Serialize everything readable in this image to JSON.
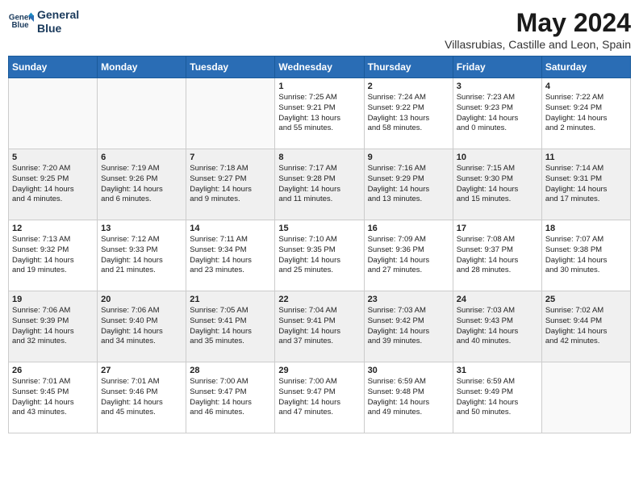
{
  "header": {
    "logo_line1": "General",
    "logo_line2": "Blue",
    "title": "May 2024",
    "location": "Villasrubias, Castille and Leon, Spain"
  },
  "days_of_week": [
    "Sunday",
    "Monday",
    "Tuesday",
    "Wednesday",
    "Thursday",
    "Friday",
    "Saturday"
  ],
  "weeks": [
    [
      {
        "day": "",
        "empty": true
      },
      {
        "day": "",
        "empty": true
      },
      {
        "day": "",
        "empty": true
      },
      {
        "day": "1",
        "lines": [
          "Sunrise: 7:25 AM",
          "Sunset: 9:21 PM",
          "Daylight: 13 hours",
          "and 55 minutes."
        ]
      },
      {
        "day": "2",
        "lines": [
          "Sunrise: 7:24 AM",
          "Sunset: 9:22 PM",
          "Daylight: 13 hours",
          "and 58 minutes."
        ]
      },
      {
        "day": "3",
        "lines": [
          "Sunrise: 7:23 AM",
          "Sunset: 9:23 PM",
          "Daylight: 14 hours",
          "and 0 minutes."
        ]
      },
      {
        "day": "4",
        "lines": [
          "Sunrise: 7:22 AM",
          "Sunset: 9:24 PM",
          "Daylight: 14 hours",
          "and 2 minutes."
        ]
      }
    ],
    [
      {
        "day": "5",
        "lines": [
          "Sunrise: 7:20 AM",
          "Sunset: 9:25 PM",
          "Daylight: 14 hours",
          "and 4 minutes."
        ],
        "shaded": true
      },
      {
        "day": "6",
        "lines": [
          "Sunrise: 7:19 AM",
          "Sunset: 9:26 PM",
          "Daylight: 14 hours",
          "and 6 minutes."
        ],
        "shaded": true
      },
      {
        "day": "7",
        "lines": [
          "Sunrise: 7:18 AM",
          "Sunset: 9:27 PM",
          "Daylight: 14 hours",
          "and 9 minutes."
        ],
        "shaded": true
      },
      {
        "day": "8",
        "lines": [
          "Sunrise: 7:17 AM",
          "Sunset: 9:28 PM",
          "Daylight: 14 hours",
          "and 11 minutes."
        ],
        "shaded": true
      },
      {
        "day": "9",
        "lines": [
          "Sunrise: 7:16 AM",
          "Sunset: 9:29 PM",
          "Daylight: 14 hours",
          "and 13 minutes."
        ],
        "shaded": true
      },
      {
        "day": "10",
        "lines": [
          "Sunrise: 7:15 AM",
          "Sunset: 9:30 PM",
          "Daylight: 14 hours",
          "and 15 minutes."
        ],
        "shaded": true
      },
      {
        "day": "11",
        "lines": [
          "Sunrise: 7:14 AM",
          "Sunset: 9:31 PM",
          "Daylight: 14 hours",
          "and 17 minutes."
        ],
        "shaded": true
      }
    ],
    [
      {
        "day": "12",
        "lines": [
          "Sunrise: 7:13 AM",
          "Sunset: 9:32 PM",
          "Daylight: 14 hours",
          "and 19 minutes."
        ]
      },
      {
        "day": "13",
        "lines": [
          "Sunrise: 7:12 AM",
          "Sunset: 9:33 PM",
          "Daylight: 14 hours",
          "and 21 minutes."
        ]
      },
      {
        "day": "14",
        "lines": [
          "Sunrise: 7:11 AM",
          "Sunset: 9:34 PM",
          "Daylight: 14 hours",
          "and 23 minutes."
        ]
      },
      {
        "day": "15",
        "lines": [
          "Sunrise: 7:10 AM",
          "Sunset: 9:35 PM",
          "Daylight: 14 hours",
          "and 25 minutes."
        ]
      },
      {
        "day": "16",
        "lines": [
          "Sunrise: 7:09 AM",
          "Sunset: 9:36 PM",
          "Daylight: 14 hours",
          "and 27 minutes."
        ]
      },
      {
        "day": "17",
        "lines": [
          "Sunrise: 7:08 AM",
          "Sunset: 9:37 PM",
          "Daylight: 14 hours",
          "and 28 minutes."
        ]
      },
      {
        "day": "18",
        "lines": [
          "Sunrise: 7:07 AM",
          "Sunset: 9:38 PM",
          "Daylight: 14 hours",
          "and 30 minutes."
        ]
      }
    ],
    [
      {
        "day": "19",
        "lines": [
          "Sunrise: 7:06 AM",
          "Sunset: 9:39 PM",
          "Daylight: 14 hours",
          "and 32 minutes."
        ],
        "shaded": true
      },
      {
        "day": "20",
        "lines": [
          "Sunrise: 7:06 AM",
          "Sunset: 9:40 PM",
          "Daylight: 14 hours",
          "and 34 minutes."
        ],
        "shaded": true
      },
      {
        "day": "21",
        "lines": [
          "Sunrise: 7:05 AM",
          "Sunset: 9:41 PM",
          "Daylight: 14 hours",
          "and 35 minutes."
        ],
        "shaded": true
      },
      {
        "day": "22",
        "lines": [
          "Sunrise: 7:04 AM",
          "Sunset: 9:41 PM",
          "Daylight: 14 hours",
          "and 37 minutes."
        ],
        "shaded": true
      },
      {
        "day": "23",
        "lines": [
          "Sunrise: 7:03 AM",
          "Sunset: 9:42 PM",
          "Daylight: 14 hours",
          "and 39 minutes."
        ],
        "shaded": true
      },
      {
        "day": "24",
        "lines": [
          "Sunrise: 7:03 AM",
          "Sunset: 9:43 PM",
          "Daylight: 14 hours",
          "and 40 minutes."
        ],
        "shaded": true
      },
      {
        "day": "25",
        "lines": [
          "Sunrise: 7:02 AM",
          "Sunset: 9:44 PM",
          "Daylight: 14 hours",
          "and 42 minutes."
        ],
        "shaded": true
      }
    ],
    [
      {
        "day": "26",
        "lines": [
          "Sunrise: 7:01 AM",
          "Sunset: 9:45 PM",
          "Daylight: 14 hours",
          "and 43 minutes."
        ]
      },
      {
        "day": "27",
        "lines": [
          "Sunrise: 7:01 AM",
          "Sunset: 9:46 PM",
          "Daylight: 14 hours",
          "and 45 minutes."
        ]
      },
      {
        "day": "28",
        "lines": [
          "Sunrise: 7:00 AM",
          "Sunset: 9:47 PM",
          "Daylight: 14 hours",
          "and 46 minutes."
        ]
      },
      {
        "day": "29",
        "lines": [
          "Sunrise: 7:00 AM",
          "Sunset: 9:47 PM",
          "Daylight: 14 hours",
          "and 47 minutes."
        ]
      },
      {
        "day": "30",
        "lines": [
          "Sunrise: 6:59 AM",
          "Sunset: 9:48 PM",
          "Daylight: 14 hours",
          "and 49 minutes."
        ]
      },
      {
        "day": "31",
        "lines": [
          "Sunrise: 6:59 AM",
          "Sunset: 9:49 PM",
          "Daylight: 14 hours",
          "and 50 minutes."
        ]
      },
      {
        "day": "",
        "empty": true
      }
    ]
  ],
  "colors": {
    "header_bg": "#2a6db5",
    "shaded_bg": "#f0f0f0",
    "empty_bg": "#f9f9f9"
  }
}
